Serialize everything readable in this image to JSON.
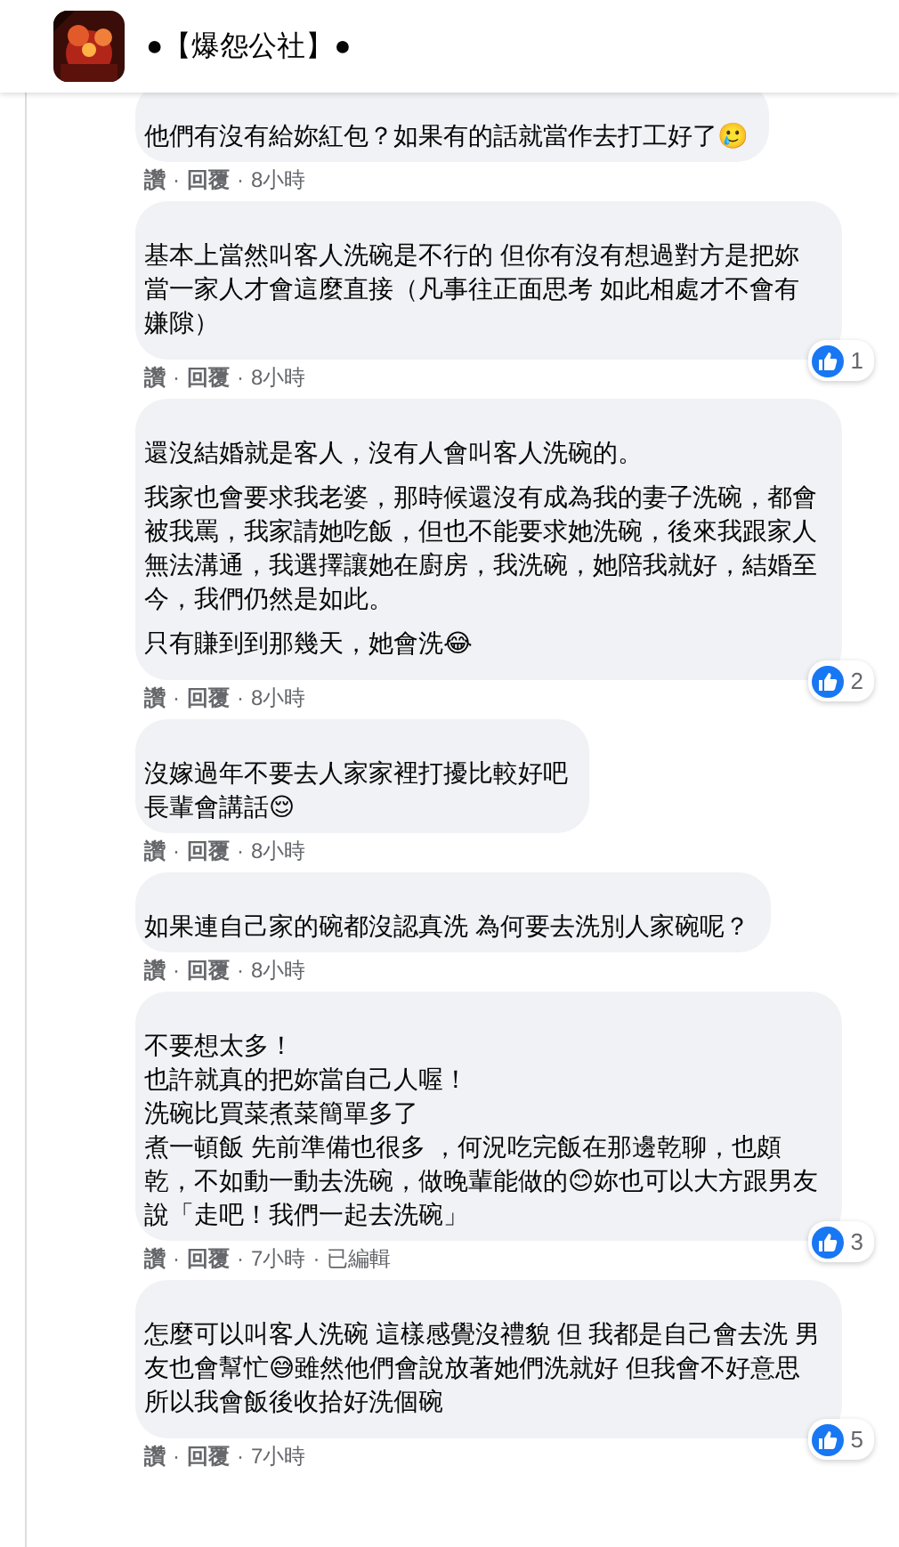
{
  "header": {
    "title": "●【爆怨公社】●"
  },
  "separator": "·",
  "comments": [
    {
      "paragraphs": [
        "他們有沒有給妳紅包？如果有的話就當作去打工好了🥲"
      ],
      "actions": [
        "讚",
        "回覆"
      ],
      "time": "8小時"
    },
    {
      "paragraphs": [
        "基本上當然叫客人洗碗是不行的 但你有沒有想過對方是把妳當一家人才會這麼直接（凡事往正面思考 如此相處才不會有嫌隙）"
      ],
      "actions": [
        "讚",
        "回覆"
      ],
      "time": "8小時",
      "reactions": "1"
    },
    {
      "paragraphs": [
        "還沒結婚就是客人，沒有人會叫客人洗碗的。",
        "我家也會要求我老婆，那時候還沒有成為我的妻子洗碗，都會被我罵，我家請她吃飯，但也不能要求她洗碗，後來我跟家人無法溝通，我選擇讓她在廚房，我洗碗，她陪我就好，結婚至今，我們仍然是如此。",
        "只有賺到到那幾天，她會洗😂"
      ],
      "actions": [
        "讚",
        "回覆"
      ],
      "time": "8小時",
      "reactions": "2"
    },
    {
      "kind": "lines",
      "paragraphs": [
        "沒嫁過年不要去人家家裡打擾比較好吧",
        "長輩會講話😌"
      ],
      "actions": [
        "讚",
        "回覆"
      ],
      "time": "8小時"
    },
    {
      "paragraphs": [
        "如果連自己家的碗都沒認真洗 為何要去洗別人家碗呢？"
      ],
      "actions": [
        "讚",
        "回覆"
      ],
      "time": "8小時"
    },
    {
      "kind": "lines",
      "paragraphs": [
        "不要想太多！",
        "也許就真的把妳當自己人喔！",
        "洗碗比買菜煮菜簡單多了",
        "煮一頓飯 先前準備也很多 ，何況吃完飯在那邊乾聊，也頗乾，不如動一動去洗碗，做晚輩能做的😊妳也可以大方跟男友說「走吧！我們一起去洗碗」"
      ],
      "actions": [
        "讚",
        "回覆"
      ],
      "time": "7小時",
      "edited": "已編輯",
      "reactions": "3"
    },
    {
      "paragraphs": [
        "怎麼可以叫客人洗碗 這樣感覺沒禮貌 但 我都是自己會去洗 男友也會幫忙😅雖然他們會說放著她們洗就好 但我會不好意思所以我會飯後收拾好洗個碗"
      ],
      "actions": [
        "讚",
        "回覆"
      ],
      "time": "7小時",
      "reactions": "5"
    }
  ]
}
